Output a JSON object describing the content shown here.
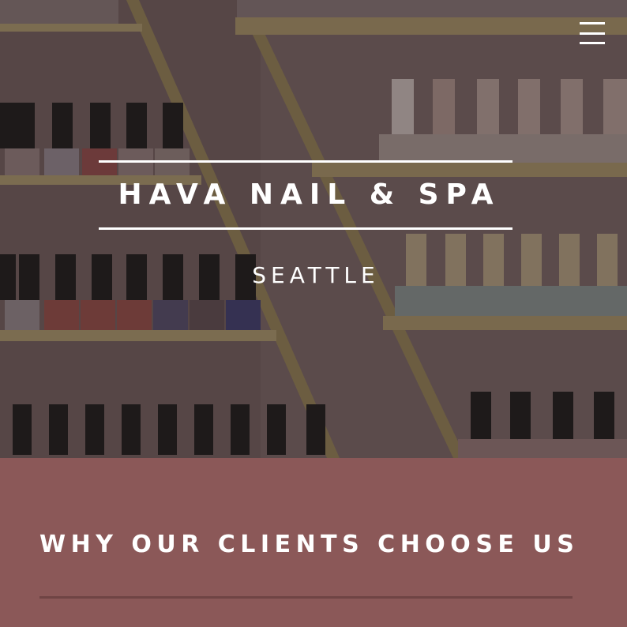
{
  "header": {
    "menu_icon": "hamburger-menu-icon"
  },
  "hero": {
    "background": "nail-polish-shelves-photo",
    "title": "HAVA NAIL & SPA",
    "subtitle": "SEATTLE"
  },
  "section": {
    "heading": "WHY OUR CLIENTS CHOOSE US",
    "background_color": "#8b5858"
  }
}
